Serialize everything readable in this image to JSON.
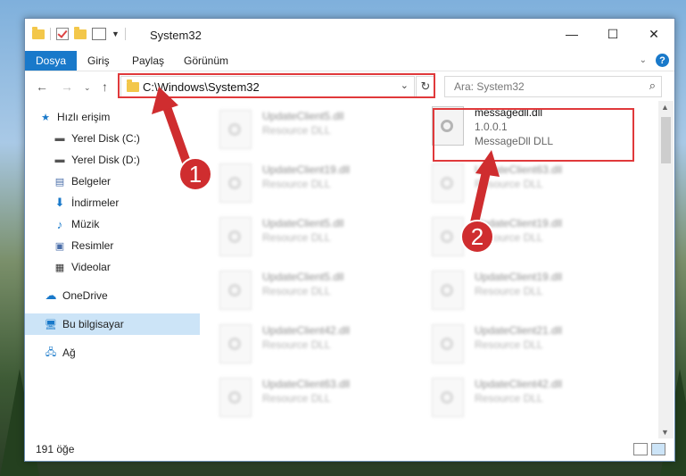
{
  "window": {
    "title": "System32",
    "controls": {
      "minimize": "—",
      "maximize": "☐",
      "close": "✕"
    }
  },
  "ribbon": {
    "tabs": [
      "Dosya",
      "Giriş",
      "Paylaş",
      "Görünüm"
    ],
    "help": "?"
  },
  "navbar": {
    "address": "C:\\Windows\\System32",
    "search_placeholder": "Ara: System32"
  },
  "sidebar": {
    "items": [
      {
        "label": "Hızlı erişim",
        "icon": "star-icon",
        "pinned": false
      },
      {
        "label": "Yerel Disk (C:)",
        "icon": "drive-icon",
        "pinned": true
      },
      {
        "label": "Yerel Disk (D:)",
        "icon": "drive-icon",
        "pinned": true
      },
      {
        "label": "Belgeler",
        "icon": "documents-icon",
        "pinned": true
      },
      {
        "label": "İndirmeler",
        "icon": "download-icon",
        "pinned": true
      },
      {
        "label": "Müzik",
        "icon": "music-icon",
        "pinned": true
      },
      {
        "label": "Resimler",
        "icon": "pictures-icon",
        "pinned": true
      },
      {
        "label": "Videolar",
        "icon": "videos-icon",
        "pinned": true
      },
      {
        "label": "OneDrive",
        "icon": "cloud-icon",
        "pinned": false
      },
      {
        "label": "Bu bilgisayar",
        "icon": "computer-icon",
        "pinned": false,
        "selected": true
      },
      {
        "label": "Ağ",
        "icon": "network-icon",
        "pinned": false
      }
    ]
  },
  "files": {
    "highlighted": {
      "name": "messagedll.dll",
      "version": "1.0.0.1",
      "description": "MessageDll DLL"
    },
    "left_column": [
      {
        "name": "UpdateClient5.dll",
        "type": "Resource DLL"
      },
      {
        "name": "UpdateClient19.dll",
        "type": "Resource DLL"
      },
      {
        "name": "UpdateClient5.dll",
        "type": "Resource DLL"
      },
      {
        "name": "UpdateClient5.dll",
        "type": "Resource DLL"
      },
      {
        "name": "UpdateClient42.dll",
        "type": "Resource DLL"
      },
      {
        "name": "UpdateClient63.dll",
        "type": "Resource DLL"
      }
    ],
    "right_column": [
      {
        "name": "UpdateClient63.dll",
        "type": "Resource DLL"
      },
      {
        "name": "UpdateClient19.dll",
        "type": "Resource DLL"
      },
      {
        "name": "UpdateClient19.dll",
        "type": "Resource DLL"
      },
      {
        "name": "UpdateClient21.dll",
        "type": "Resource DLL"
      },
      {
        "name": "UpdateClient42.dll",
        "type": "Resource DLL"
      }
    ]
  },
  "status": {
    "count": "191 öğe"
  },
  "annotations": {
    "step1": "1",
    "step2": "2",
    "accent": "#e0393b"
  }
}
